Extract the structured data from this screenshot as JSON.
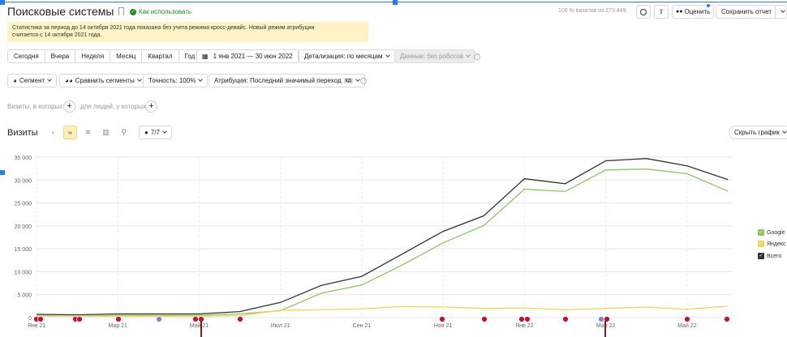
{
  "header": {
    "title": "Поисковые системы",
    "how_to_use": "Как использовать",
    "visits_info": "100 % визитов из 273 449",
    "rate_label": "Оценить",
    "save_report": "Сохранить отчет"
  },
  "notice": {
    "line1": "Статистика за период до 14 октября 2021 года показана без учета режима кросс-девайс. Новый режим атрибуции",
    "line2": "считается с 14 октября 2021 года."
  },
  "period_buttons": [
    "Сегодня",
    "Вчера",
    "Неделя",
    "Месяц",
    "Квартал",
    "Год"
  ],
  "date_range": "1 янв 2021 — 30 июн 2022",
  "detail": "Детализация: по месяцам",
  "data_filter": "Данные: без роботов",
  "filters": {
    "segment": "Сегмент",
    "compare": "Сравнить сегменты",
    "accuracy": "Точность: 100%",
    "attribution": "Атрибуция: Последний значимый переход",
    "attribution_badge": "кд"
  },
  "conditions": {
    "visits_where": "Визиты, в которых",
    "people_where": "для людей, у которых"
  },
  "chart_header": {
    "title": "Визиты",
    "metric_count": "7/7",
    "hide_chart": "Скрыть график"
  },
  "colors": {
    "google": "#8cc665",
    "yandex": "#f2d35e",
    "total": "#333333",
    "accent": "#2a8a2a",
    "notice_bg": "#fdf3c4",
    "marker": "#c8102e"
  },
  "chart_data": {
    "type": "line",
    "x": [
      "2021-01",
      "2021-02",
      "2021-03",
      "2021-04",
      "2021-05",
      "2021-06",
      "2021-07",
      "2021-08",
      "2021-09",
      "2021-10",
      "2021-11",
      "2021-12",
      "2022-01",
      "2022-02",
      "2022-03",
      "2022-04",
      "2022-05",
      "2022-06"
    ],
    "x_tick_labels": [
      "Янв 21",
      "Мар 21",
      "Май 21",
      "Июл 21",
      "Сен 21",
      "Ноя 21",
      "Янв 22",
      "Мар 22",
      "Май 22"
    ],
    "x_tick_index": [
      0,
      2,
      4,
      6,
      8,
      10,
      12,
      14,
      16
    ],
    "y_ticks": [
      "0",
      "5 000",
      "10 000",
      "15 000",
      "20 000",
      "25 000",
      "30 000",
      "35 000"
    ],
    "ylim": [
      0,
      35000
    ],
    "series": [
      {
        "name": "Google",
        "color": "#8cc665",
        "values": [
          400,
          300,
          500,
          500,
          500,
          800,
          1500,
          5300,
          7100,
          11500,
          16300,
          20100,
          28000,
          27500,
          32200,
          32400,
          31400,
          27600
        ]
      },
      {
        "name": "Яндекс",
        "color": "#f2d35e",
        "values": [
          300,
          300,
          300,
          300,
          300,
          400,
          1600,
          1700,
          1900,
          2400,
          2300,
          2000,
          2100,
          1700,
          2000,
          2300,
          1800,
          2500
        ]
      },
      {
        "name": "Всего",
        "color": "#333333",
        "values": [
          700,
          600,
          800,
          800,
          800,
          1300,
          3300,
          7000,
          9000,
          13900,
          18800,
          22200,
          30300,
          29200,
          34200,
          34700,
          33100,
          30100
        ]
      }
    ],
    "grid": true,
    "legend_position": "right"
  }
}
